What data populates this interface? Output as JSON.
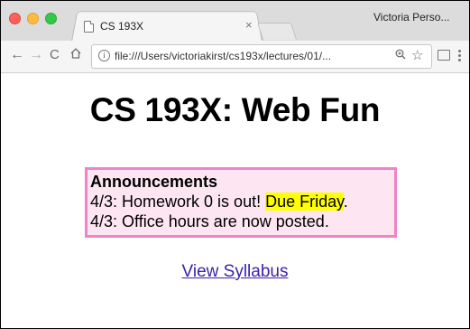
{
  "browser": {
    "tab_title": "CS 193X",
    "tab_close": "×",
    "profile": "Victoria Perso...",
    "url": "file:///Users/victoriakirst/cs193x/lectures/01/...",
    "nav": {
      "back": "←",
      "forward": "→",
      "reload": "C"
    },
    "icons": [
      "page-icon",
      "close-icon",
      "back-arrow-icon",
      "forward-arrow-icon",
      "reload-icon",
      "home-icon",
      "info-icon",
      "zoom-icon",
      "star-icon",
      "cast-icon",
      "menu-icon"
    ]
  },
  "page": {
    "title": "CS 193X: Web Fun",
    "announcements": {
      "heading": "Announcements",
      "line1_prefix": "4/3: Homework 0 is out! ",
      "line1_highlight": "Due Friday",
      "line1_suffix": ".",
      "line2": "4/3: Office hours are now posted."
    },
    "link_text": "View Syllabus"
  },
  "colors": {
    "announcement_border": "#f082c7",
    "announcement_bg": "#fde6f1",
    "highlight": "#ffff00",
    "link": "#3b1fa8"
  }
}
